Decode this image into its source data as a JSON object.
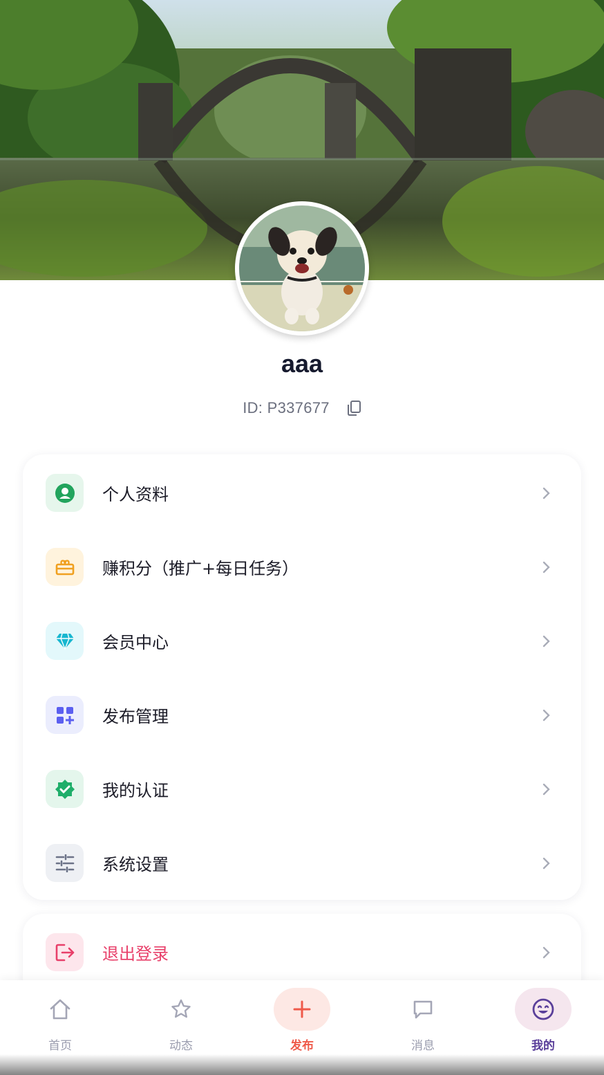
{
  "profile": {
    "username": "aaa",
    "id_text": "ID: P337677",
    "copy_icon": "copy-icon",
    "banner": "stone arch bridge reflected in lake",
    "avatar": "dog avatar"
  },
  "menu": {
    "items": [
      {
        "label": "个人资料",
        "icon": "user-circle-icon",
        "icon_color": "#22a45d",
        "icon_bg": "#e6f6ec"
      },
      {
        "label": "赚积分（推广+每日任务）",
        "icon": "gift-icon",
        "icon_color": "#f0a020",
        "icon_bg": "#fff3dd"
      },
      {
        "label": "会员中心",
        "icon": "diamond-icon",
        "icon_color": "#18b7d0",
        "icon_bg": "#e3f8fb"
      },
      {
        "label": "发布管理",
        "icon": "grid-plus-icon",
        "icon_color": "#5b5ff0",
        "icon_bg": "#ebedfd"
      },
      {
        "label": "我的认证",
        "icon": "verified-badge-icon",
        "icon_color": "#1fae6a",
        "icon_bg": "#e4f6ec"
      },
      {
        "label": "系统设置",
        "icon": "sliders-icon",
        "icon_color": "#6c7388",
        "icon_bg": "#eef0f4"
      }
    ],
    "logout": {
      "label": "退出登录",
      "icon": "logout-icon",
      "color": "#e8406a",
      "icon_bg": "#fde6ec"
    }
  },
  "nav": {
    "items": [
      {
        "label": "首页",
        "icon": "home-icon"
      },
      {
        "label": "动态",
        "icon": "star-icon"
      },
      {
        "label": "发布",
        "icon": "plus-icon",
        "color": "#ef5a4a"
      },
      {
        "label": "消息",
        "icon": "chat-icon"
      },
      {
        "label": "我的",
        "icon": "smile-icon",
        "color": "#5a3f9a",
        "active": true
      }
    ]
  },
  "colors": {
    "accent_publish": "#ef5a4a",
    "accent_active": "#5a3f9a",
    "chevron": "#a9acb8"
  }
}
